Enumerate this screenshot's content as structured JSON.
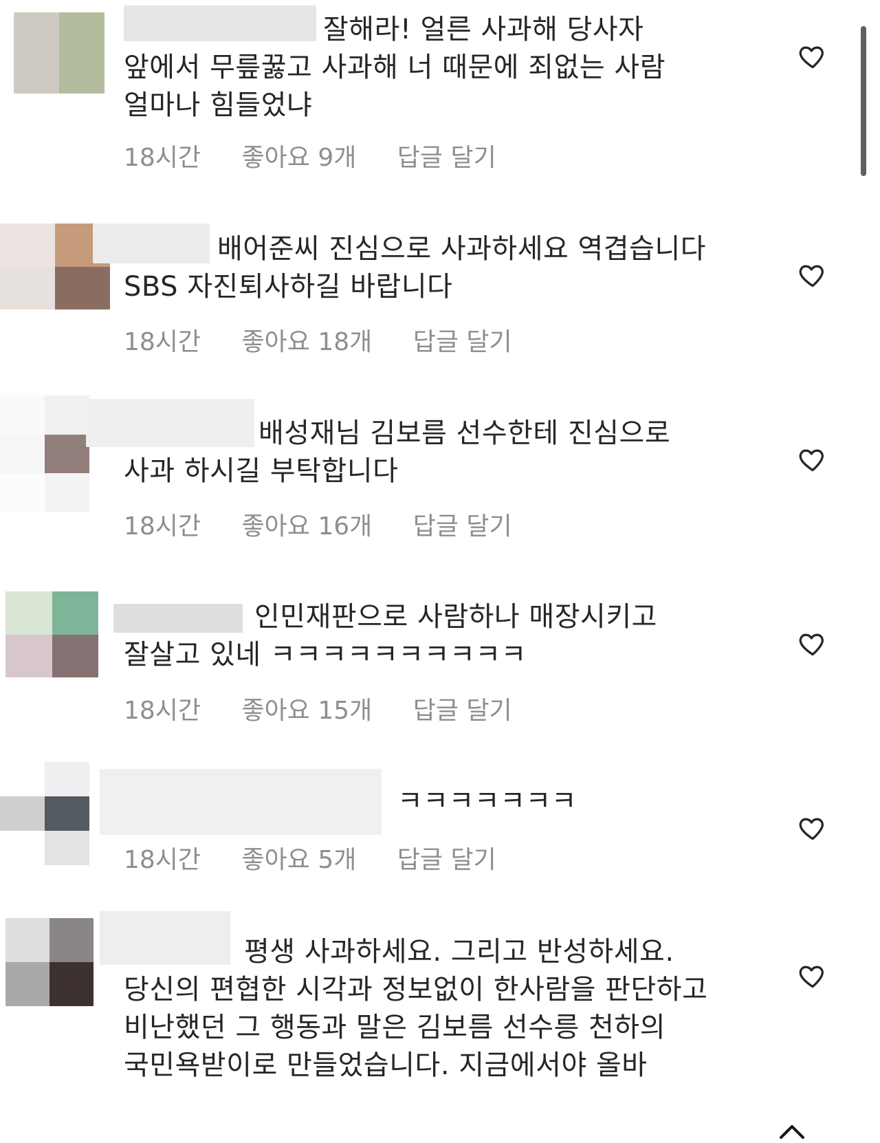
{
  "comments": [
    {
      "text": "잘해라! 얼른 사과해 당사자 앞에서 무릎꿇고 사과해 너 때문에 죄없는 사람 얼마나 힘들었냐",
      "time": "18시간",
      "likes": "좋아요 9개",
      "reply": "답글 달기"
    },
    {
      "text": "배어준씨 진심으로 사과하세요 역겹습니다 SBS 자진퇴사하길 바랍니다",
      "time": "18시간",
      "likes": "좋아요 18개",
      "reply": "답글 달기"
    },
    {
      "text": "배성재님 김보름 선수한테 진심으로 사과 하시길 부탁합니다",
      "time": "18시간",
      "likes": "좋아요 16개",
      "reply": "답글 달기"
    },
    {
      "text": "인민재판으로 사람하나 매장시키고 잘살고 있네 ㅋㅋㅋㅋㅋㅋㅋㅋㅋㅋ",
      "time": "18시간",
      "likes": "좋아요 15개",
      "reply": "답글 달기"
    },
    {
      "text": "ㅋㅋㅋㅋㅋㅋㅋ",
      "time": "18시간",
      "likes": "좋아요 5개",
      "reply": "답글 달기"
    },
    {
      "text": "평생 사과하세요. 그리고 반성하세요. 당신의 편협한 시각과 정보없이 한사람을 판단하고 비난했던 그 행동과 말은 김보름 선수릉 천하의 국민욕받이로 만들었습니다. 지금에서야 올바"
    }
  ],
  "icons": {
    "like": "heart-outline-icon",
    "scroll": "chevron-up-icon"
  },
  "colors": {
    "text": "#262626",
    "meta": "#8e8e8e",
    "heart": "#262626"
  }
}
